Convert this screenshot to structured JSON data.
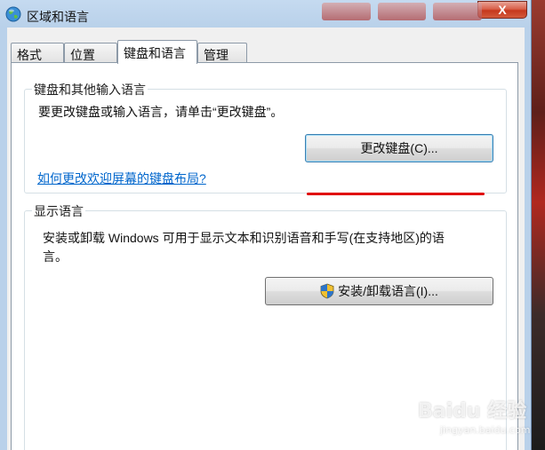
{
  "window": {
    "title": "区域和语言",
    "close_label": "X"
  },
  "tabs": [
    {
      "label": "格式"
    },
    {
      "label": "位置"
    },
    {
      "label": "键盘和语言"
    },
    {
      "label": "管理"
    }
  ],
  "keyboard_group": {
    "title": "键盘和其他输入语言",
    "description": "要更改键盘或输入语言，请单击“更改键盘”。",
    "change_button": "更改键盘(C)...",
    "welcome_link": "如何更改欢迎屏幕的键盘布局?"
  },
  "display_group": {
    "title": "显示语言",
    "description_line1": "安装或卸载 Windows 可用于显示文本和识别语音和手写(在支持地区)的语",
    "description_line2": "言。",
    "install_button": "安装/卸载语言(I)..."
  },
  "watermark": {
    "brand": "Baidu 经验",
    "url": "jingyan.baidu.com"
  },
  "colors": {
    "annotation_red": "#e00000",
    "link_blue": "#0066cc"
  }
}
